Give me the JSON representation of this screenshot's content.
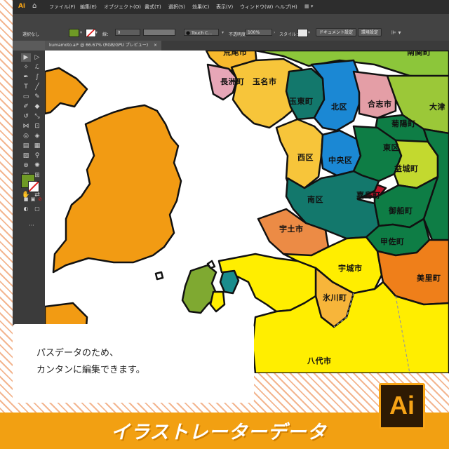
{
  "app": {
    "logo": "Ai",
    "menu": [
      "ファイル(F)",
      "編集(E)",
      "オブジェクト(O)",
      "書式(T)",
      "選択(S)",
      "効果(C)",
      "表示(V)",
      "ウィンドウ(W)",
      "ヘルプ(H)"
    ],
    "control": {
      "selection": "選択なし",
      "fill_color": "#6f9a25",
      "stroke_label": "線：",
      "brush": "Touch C...",
      "opacity_label": "不透明度：",
      "opacity_value": "100%",
      "style_label": "スタイル：",
      "doc_setup": "ドキュメント設定",
      "preferences": "環境設定"
    },
    "doc_tab": "kumamoto.ai* @ 66.67% (RGB/GPU プレビュー)",
    "doc_tab_close": "×"
  },
  "map": {
    "labels": [
      {
        "id": "arao",
        "text": "荒尾市"
      },
      {
        "id": "nankan",
        "text": "南関町"
      },
      {
        "id": "nagasu",
        "text": "長洲町"
      },
      {
        "id": "tamana",
        "text": "玉名市"
      },
      {
        "id": "gyokuto",
        "text": "玉東町"
      },
      {
        "id": "kita",
        "text": "北区"
      },
      {
        "id": "koshi",
        "text": "合志市"
      },
      {
        "id": "ozu",
        "text": "大津"
      },
      {
        "id": "kikuyo",
        "text": "菊陽町"
      },
      {
        "id": "nishi",
        "text": "西区"
      },
      {
        "id": "chuo",
        "text": "中央区"
      },
      {
        "id": "higashi",
        "text": "東区"
      },
      {
        "id": "mashiki",
        "text": "益城町"
      },
      {
        "id": "minami",
        "text": "南区"
      },
      {
        "id": "kashima",
        "text": "嘉島町"
      },
      {
        "id": "mifune",
        "text": "御船町"
      },
      {
        "id": "uto",
        "text": "宇土市"
      },
      {
        "id": "kosa",
        "text": "甲佐町"
      },
      {
        "id": "uki",
        "text": "宇城市"
      },
      {
        "id": "misato",
        "text": "美里町"
      },
      {
        "id": "hikawa",
        "text": "氷川町"
      },
      {
        "id": "yatsushiro",
        "text": "八代市"
      }
    ]
  },
  "caption": {
    "line1": "パスデータのため、",
    "line2": "カンタンに編集できます。"
  },
  "footer": {
    "title": "イラストレーターデータ",
    "badge": "Ai"
  },
  "colors": {
    "footer": "#f2a012",
    "stripe": "#f3b58f",
    "badge_bg": "#2e1a03",
    "badge_fg": "#f7a416"
  }
}
